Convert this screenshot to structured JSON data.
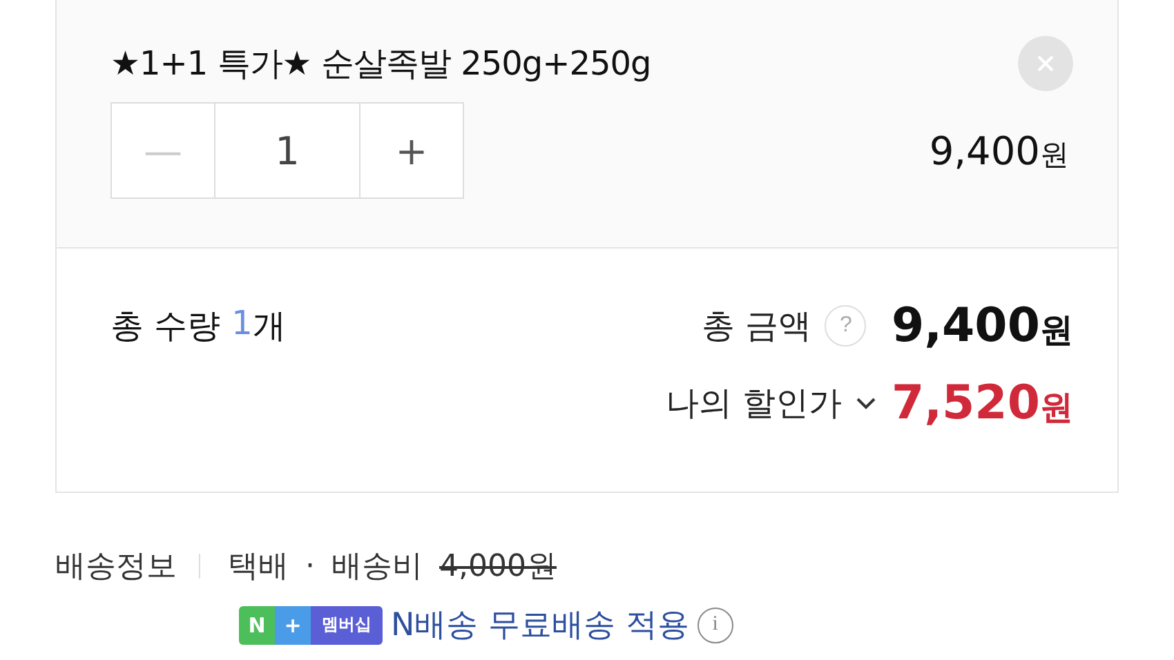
{
  "item": {
    "name": "★1+1 특가★ 순살족발 250g+250g",
    "minus": "—",
    "quantity": "1",
    "plus": "+",
    "price": "9,400",
    "price_unit": "원"
  },
  "summary": {
    "qty_label": "총 수량",
    "qty_count": "1",
    "qty_unit": "개",
    "total_label": "총 금액",
    "help": "?",
    "total": "9,400",
    "total_unit": "원",
    "discount_label": "나의 할인가",
    "discount": "7,520",
    "discount_unit": "원"
  },
  "shipping": {
    "label": "배송정보",
    "method": "택배",
    "dot": "·",
    "fee_label": "배송비",
    "fee": "4,000원",
    "fee_struck": true,
    "badge": [
      {
        "text": "N",
        "color": "#4cbf5a"
      },
      {
        "text": "+",
        "color": "#4a9be8"
      },
      {
        "text": "멤버십",
        "color": "#5b5fd6"
      }
    ],
    "benefit": "N배송 무료배송 적용",
    "info": "i"
  }
}
